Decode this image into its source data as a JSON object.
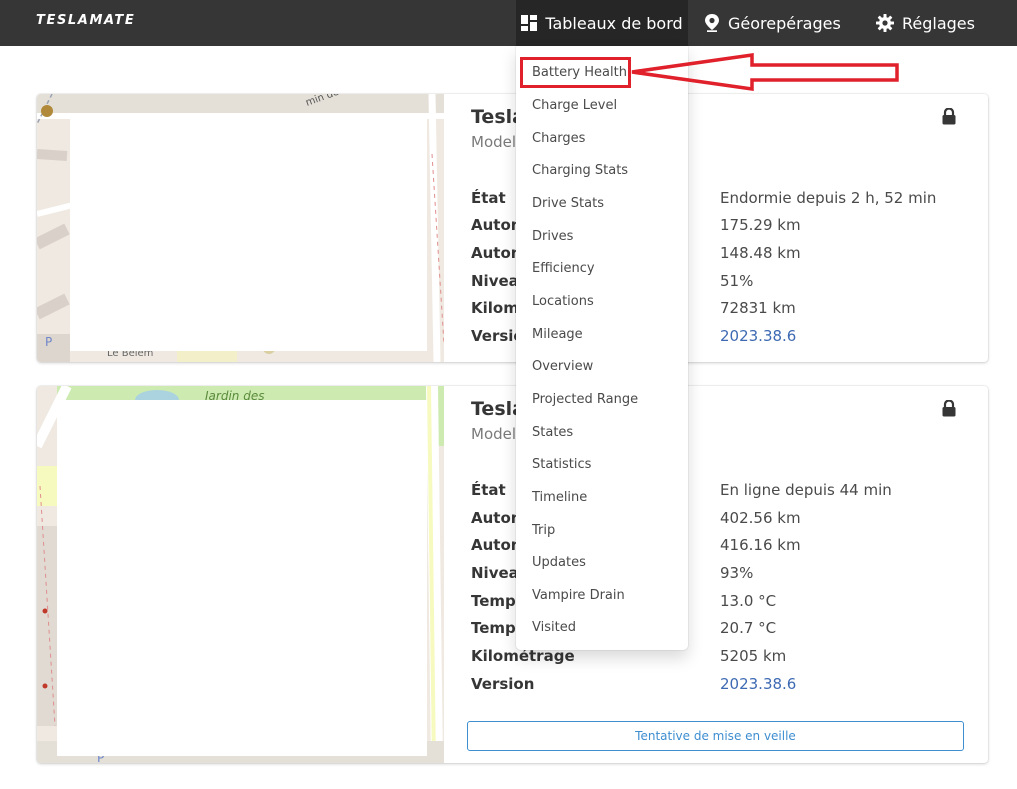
{
  "brand": "TESLAMATE",
  "nav": {
    "dashboards": "Tableaux de bord",
    "geofences": "Géorepérages",
    "settings": "Réglages"
  },
  "dashboards_menu": [
    "Battery Health",
    "Charge Level",
    "Charges",
    "Charging Stats",
    "Drive Stats",
    "Drives",
    "Efficiency",
    "Locations",
    "Mileage",
    "Overview",
    "Projected Range",
    "States",
    "Statistics",
    "Timeline",
    "Trip",
    "Updates",
    "Vampire Drain",
    "Visited"
  ],
  "highlighted_item": "Battery Health",
  "colors": {
    "navbar": "#363636",
    "link": "#3e6ab3",
    "highlight": "#e0202a",
    "button": "#3e8ed0"
  },
  "cars": [
    {
      "name": "Tesla",
      "model": "Model",
      "status_icon": "lock-icon",
      "map_labels": [
        "min de le",
        "Le Belem"
      ],
      "rows": [
        {
          "k": "État",
          "v": "Endormie depuis 2 h, 52 min"
        },
        {
          "k": "Auton",
          "v": "175.29 km"
        },
        {
          "k": "Auton",
          "v": "148.48 km"
        },
        {
          "k": "Niveau",
          "v": "51%"
        },
        {
          "k": "Kilome",
          "v": "72831 km"
        },
        {
          "k": "Version",
          "v": "2023.38.6",
          "link": true
        }
      ]
    },
    {
      "name": "Tesla",
      "model": "Model",
      "status_icon": "lock-icon",
      "map_labels": [
        "Jardin des"
      ],
      "rows": [
        {
          "k": "État",
          "v": "En ligne depuis 44 min"
        },
        {
          "k": "Auton",
          "v": "402.56 km"
        },
        {
          "k": "Auton",
          "v": "416.16 km"
        },
        {
          "k": "Niveau",
          "v": "93%"
        },
        {
          "k": "Tempé",
          "v": "13.0 °C"
        },
        {
          "k": "Tempé",
          "v": "20.7 °C"
        },
        {
          "k": "Kilométrage",
          "v": "5205 km"
        },
        {
          "k": "Version",
          "v": "2023.38.6",
          "link": true
        }
      ],
      "button": "Tentative de mise en veille"
    }
  ]
}
